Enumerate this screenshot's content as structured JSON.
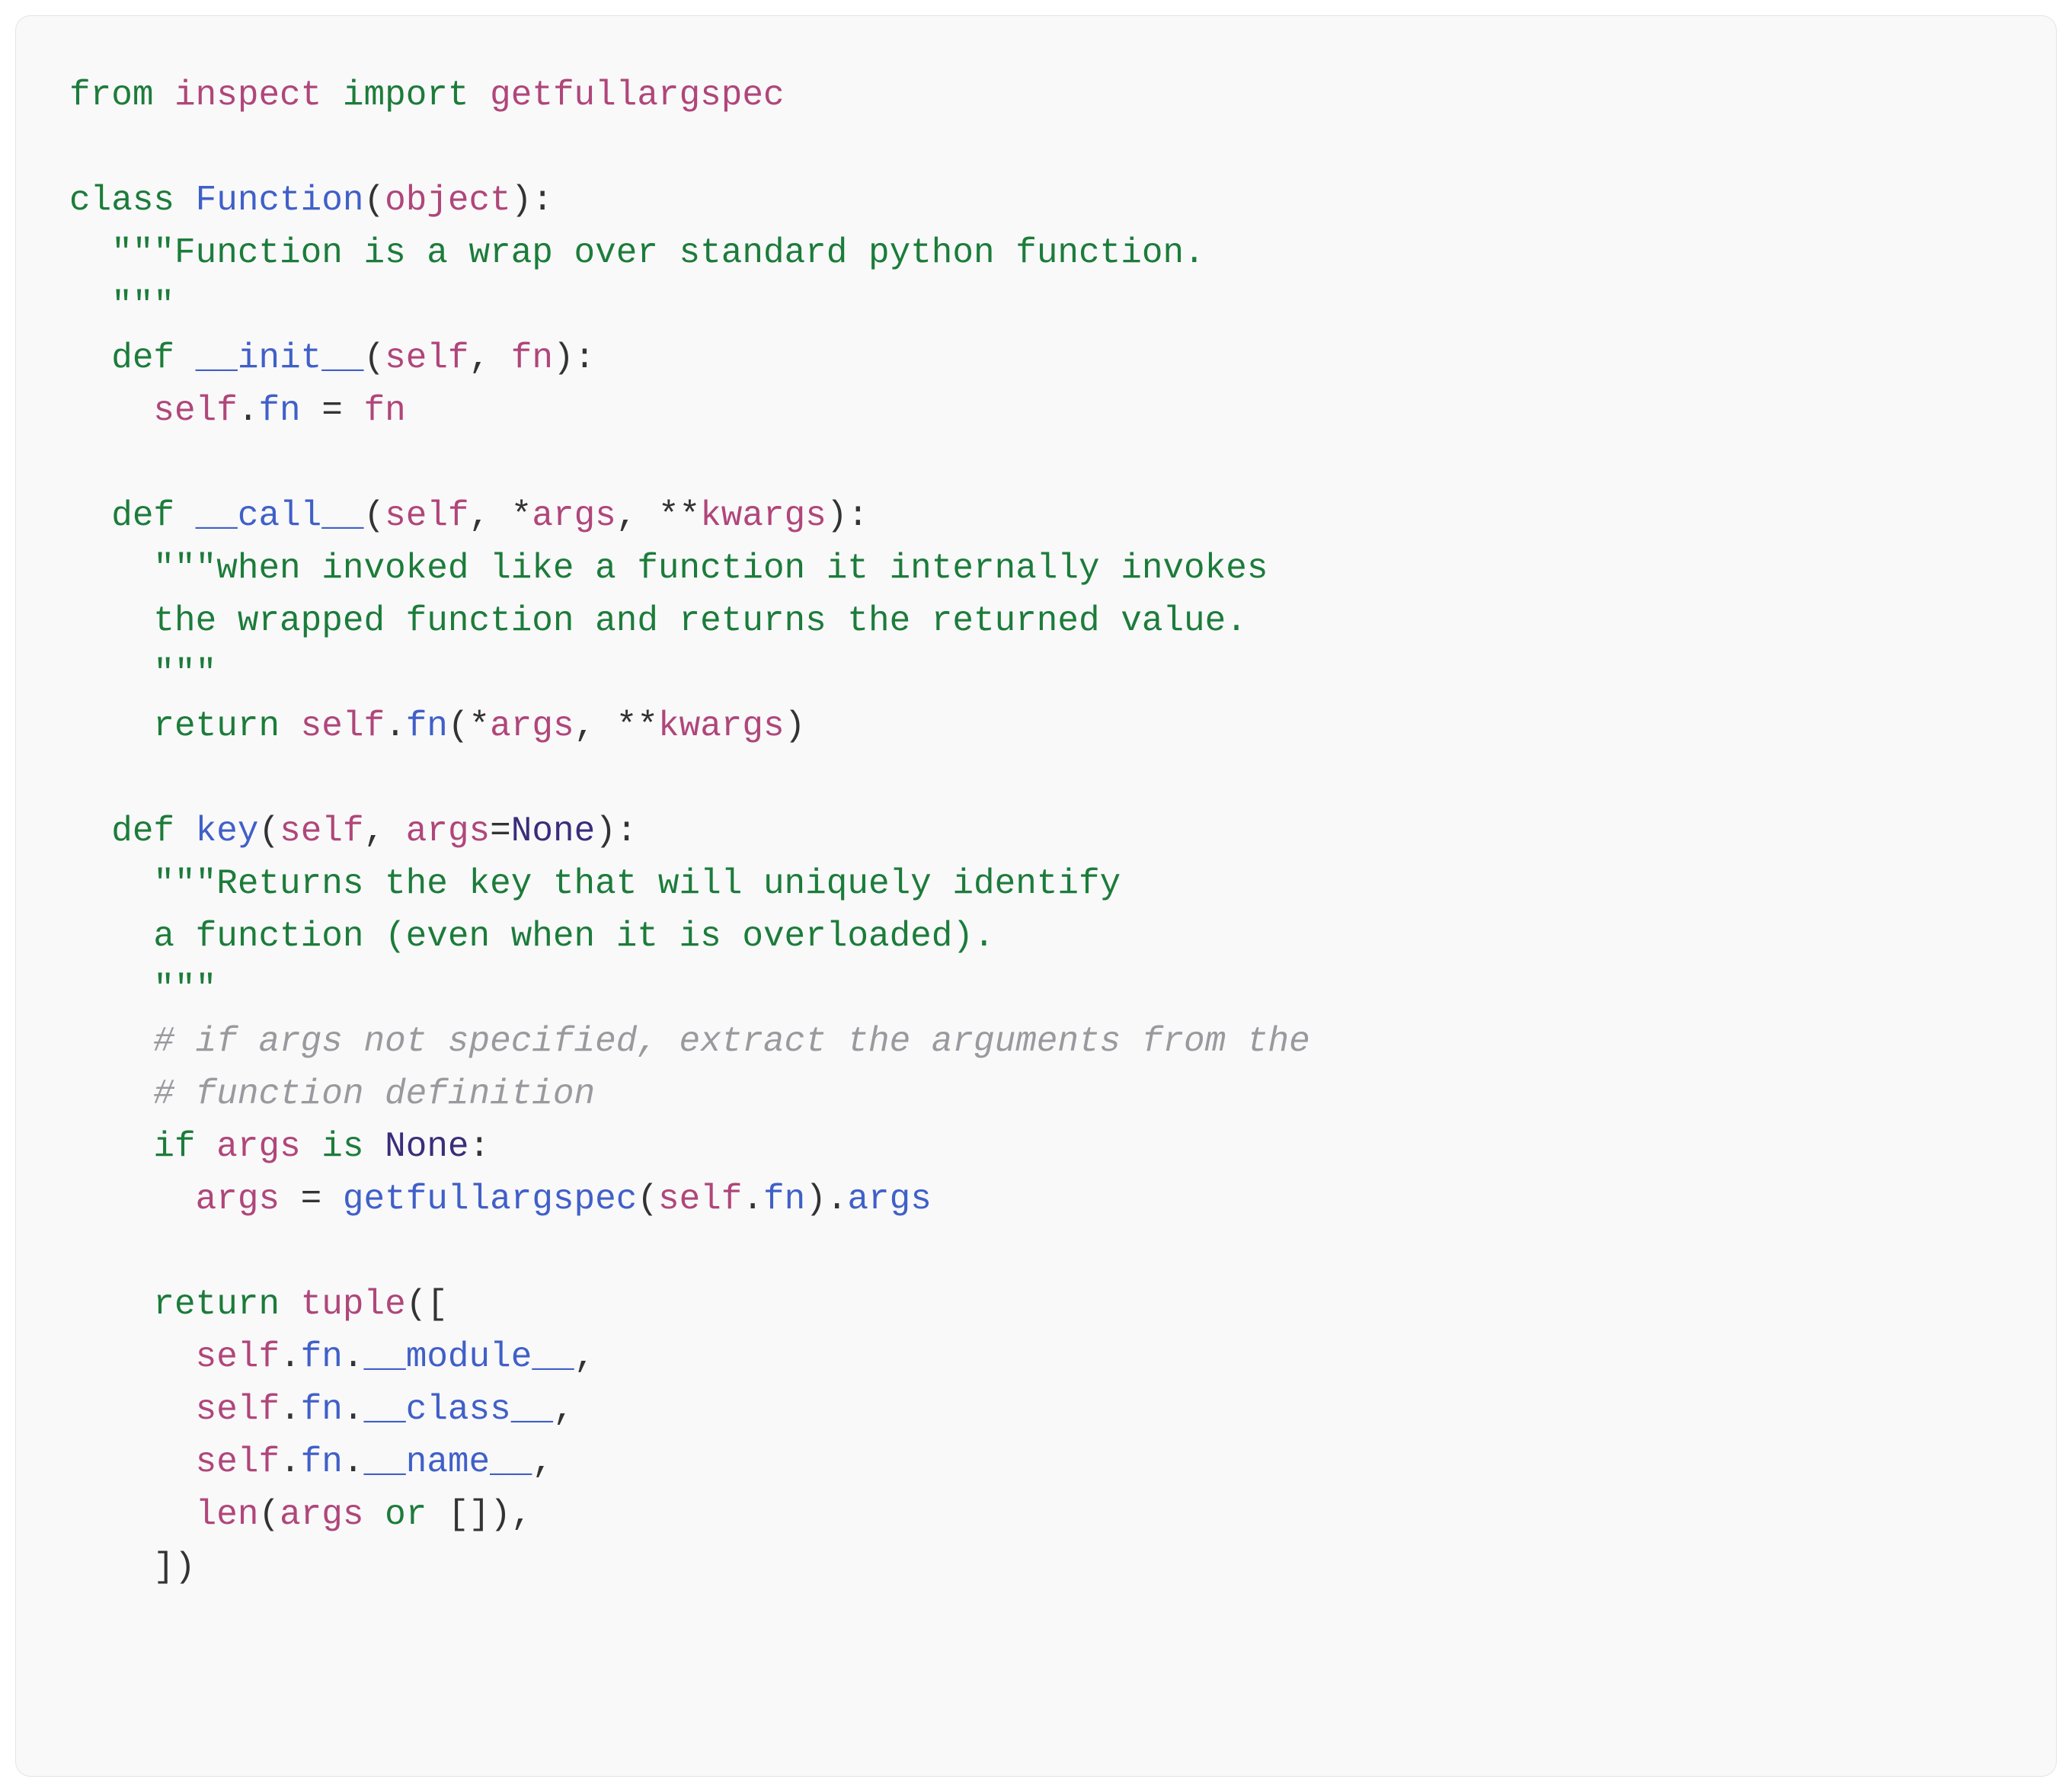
{
  "code": {
    "lines": [
      [
        {
          "cls": "kw",
          "t": "from"
        },
        {
          "cls": "op",
          "t": " "
        },
        {
          "cls": "nm",
          "t": "inspect"
        },
        {
          "cls": "op",
          "t": " "
        },
        {
          "cls": "kw",
          "t": "import"
        },
        {
          "cls": "op",
          "t": " "
        },
        {
          "cls": "nm",
          "t": "getfullargspec"
        }
      ],
      [],
      [
        {
          "cls": "kw",
          "t": "class"
        },
        {
          "cls": "op",
          "t": " "
        },
        {
          "cls": "cls",
          "t": "Function"
        },
        {
          "cls": "op",
          "t": "("
        },
        {
          "cls": "builtin",
          "t": "object"
        },
        {
          "cls": "op",
          "t": "):"
        }
      ],
      [
        {
          "cls": "op",
          "t": "  "
        },
        {
          "cls": "str",
          "t": "\"\"\"Function is a wrap over standard python function."
        }
      ],
      [
        {
          "cls": "op",
          "t": "  "
        },
        {
          "cls": "str",
          "t": "\"\"\""
        }
      ],
      [
        {
          "cls": "op",
          "t": "  "
        },
        {
          "cls": "kw",
          "t": "def"
        },
        {
          "cls": "op",
          "t": " "
        },
        {
          "cls": "fn",
          "t": "__init__"
        },
        {
          "cls": "op",
          "t": "("
        },
        {
          "cls": "self",
          "t": "self"
        },
        {
          "cls": "op",
          "t": ", "
        },
        {
          "cls": "nm",
          "t": "fn"
        },
        {
          "cls": "op",
          "t": "):"
        }
      ],
      [
        {
          "cls": "op",
          "t": "    "
        },
        {
          "cls": "self",
          "t": "self"
        },
        {
          "cls": "op",
          "t": "."
        },
        {
          "cls": "attr",
          "t": "fn"
        },
        {
          "cls": "op",
          "t": " = "
        },
        {
          "cls": "nm",
          "t": "fn"
        }
      ],
      [],
      [
        {
          "cls": "op",
          "t": "  "
        },
        {
          "cls": "kw",
          "t": "def"
        },
        {
          "cls": "op",
          "t": " "
        },
        {
          "cls": "fn",
          "t": "__call__"
        },
        {
          "cls": "op",
          "t": "("
        },
        {
          "cls": "self",
          "t": "self"
        },
        {
          "cls": "op",
          "t": ", *"
        },
        {
          "cls": "nm",
          "t": "args"
        },
        {
          "cls": "op",
          "t": ", **"
        },
        {
          "cls": "nm",
          "t": "kwargs"
        },
        {
          "cls": "op",
          "t": "):"
        }
      ],
      [
        {
          "cls": "op",
          "t": "    "
        },
        {
          "cls": "str",
          "t": "\"\"\"when invoked like a function it internally invokes"
        }
      ],
      [
        {
          "cls": "op",
          "t": "    "
        },
        {
          "cls": "str",
          "t": "the wrapped function and returns the returned value."
        }
      ],
      [
        {
          "cls": "op",
          "t": "    "
        },
        {
          "cls": "str",
          "t": "\"\"\""
        }
      ],
      [
        {
          "cls": "op",
          "t": "    "
        },
        {
          "cls": "kw",
          "t": "return"
        },
        {
          "cls": "op",
          "t": " "
        },
        {
          "cls": "self",
          "t": "self"
        },
        {
          "cls": "op",
          "t": "."
        },
        {
          "cls": "attr",
          "t": "fn"
        },
        {
          "cls": "op",
          "t": "(*"
        },
        {
          "cls": "nm",
          "t": "args"
        },
        {
          "cls": "op",
          "t": ", **"
        },
        {
          "cls": "nm",
          "t": "kwargs"
        },
        {
          "cls": "op",
          "t": ")"
        }
      ],
      [],
      [
        {
          "cls": "op",
          "t": "  "
        },
        {
          "cls": "kw",
          "t": "def"
        },
        {
          "cls": "op",
          "t": " "
        },
        {
          "cls": "fn",
          "t": "key"
        },
        {
          "cls": "op",
          "t": "("
        },
        {
          "cls": "self",
          "t": "self"
        },
        {
          "cls": "op",
          "t": ", "
        },
        {
          "cls": "nm",
          "t": "args"
        },
        {
          "cls": "op",
          "t": "="
        },
        {
          "cls": "const",
          "t": "None"
        },
        {
          "cls": "op",
          "t": "):"
        }
      ],
      [
        {
          "cls": "op",
          "t": "    "
        },
        {
          "cls": "str",
          "t": "\"\"\"Returns the key that will uniquely identify"
        }
      ],
      [
        {
          "cls": "op",
          "t": "    "
        },
        {
          "cls": "str",
          "t": "a function (even when it is overloaded)."
        }
      ],
      [
        {
          "cls": "op",
          "t": "    "
        },
        {
          "cls": "str",
          "t": "\"\"\""
        }
      ],
      [
        {
          "cls": "op",
          "t": "    "
        },
        {
          "cls": "cmt",
          "t": "# if args not specified, extract the arguments from the"
        }
      ],
      [
        {
          "cls": "op",
          "t": "    "
        },
        {
          "cls": "cmt",
          "t": "# function definition"
        }
      ],
      [
        {
          "cls": "op",
          "t": "    "
        },
        {
          "cls": "kw",
          "t": "if"
        },
        {
          "cls": "op",
          "t": " "
        },
        {
          "cls": "nm",
          "t": "args"
        },
        {
          "cls": "op",
          "t": " "
        },
        {
          "cls": "kw",
          "t": "is"
        },
        {
          "cls": "op",
          "t": " "
        },
        {
          "cls": "const",
          "t": "None"
        },
        {
          "cls": "op",
          "t": ":"
        }
      ],
      [
        {
          "cls": "op",
          "t": "      "
        },
        {
          "cls": "nm",
          "t": "args"
        },
        {
          "cls": "op",
          "t": " = "
        },
        {
          "cls": "fn",
          "t": "getfullargspec"
        },
        {
          "cls": "op",
          "t": "("
        },
        {
          "cls": "self",
          "t": "self"
        },
        {
          "cls": "op",
          "t": "."
        },
        {
          "cls": "attr",
          "t": "fn"
        },
        {
          "cls": "op",
          "t": ")."
        },
        {
          "cls": "attr",
          "t": "args"
        }
      ],
      [],
      [
        {
          "cls": "op",
          "t": "    "
        },
        {
          "cls": "kw",
          "t": "return"
        },
        {
          "cls": "op",
          "t": " "
        },
        {
          "cls": "builtin",
          "t": "tuple"
        },
        {
          "cls": "op",
          "t": "(["
        }
      ],
      [
        {
          "cls": "op",
          "t": "      "
        },
        {
          "cls": "self",
          "t": "self"
        },
        {
          "cls": "op",
          "t": "."
        },
        {
          "cls": "attr",
          "t": "fn"
        },
        {
          "cls": "op",
          "t": "."
        },
        {
          "cls": "attr",
          "t": "__module__"
        },
        {
          "cls": "op",
          "t": ","
        }
      ],
      [
        {
          "cls": "op",
          "t": "      "
        },
        {
          "cls": "self",
          "t": "self"
        },
        {
          "cls": "op",
          "t": "."
        },
        {
          "cls": "attr",
          "t": "fn"
        },
        {
          "cls": "op",
          "t": "."
        },
        {
          "cls": "attr",
          "t": "__class__"
        },
        {
          "cls": "op",
          "t": ","
        }
      ],
      [
        {
          "cls": "op",
          "t": "      "
        },
        {
          "cls": "self",
          "t": "self"
        },
        {
          "cls": "op",
          "t": "."
        },
        {
          "cls": "attr",
          "t": "fn"
        },
        {
          "cls": "op",
          "t": "."
        },
        {
          "cls": "attr",
          "t": "__name__"
        },
        {
          "cls": "op",
          "t": ","
        }
      ],
      [
        {
          "cls": "op",
          "t": "      "
        },
        {
          "cls": "builtin",
          "t": "len"
        },
        {
          "cls": "op",
          "t": "("
        },
        {
          "cls": "nm",
          "t": "args"
        },
        {
          "cls": "op",
          "t": " "
        },
        {
          "cls": "kw",
          "t": "or"
        },
        {
          "cls": "op",
          "t": " []),"
        }
      ],
      [
        {
          "cls": "op",
          "t": "    ])"
        }
      ]
    ]
  }
}
